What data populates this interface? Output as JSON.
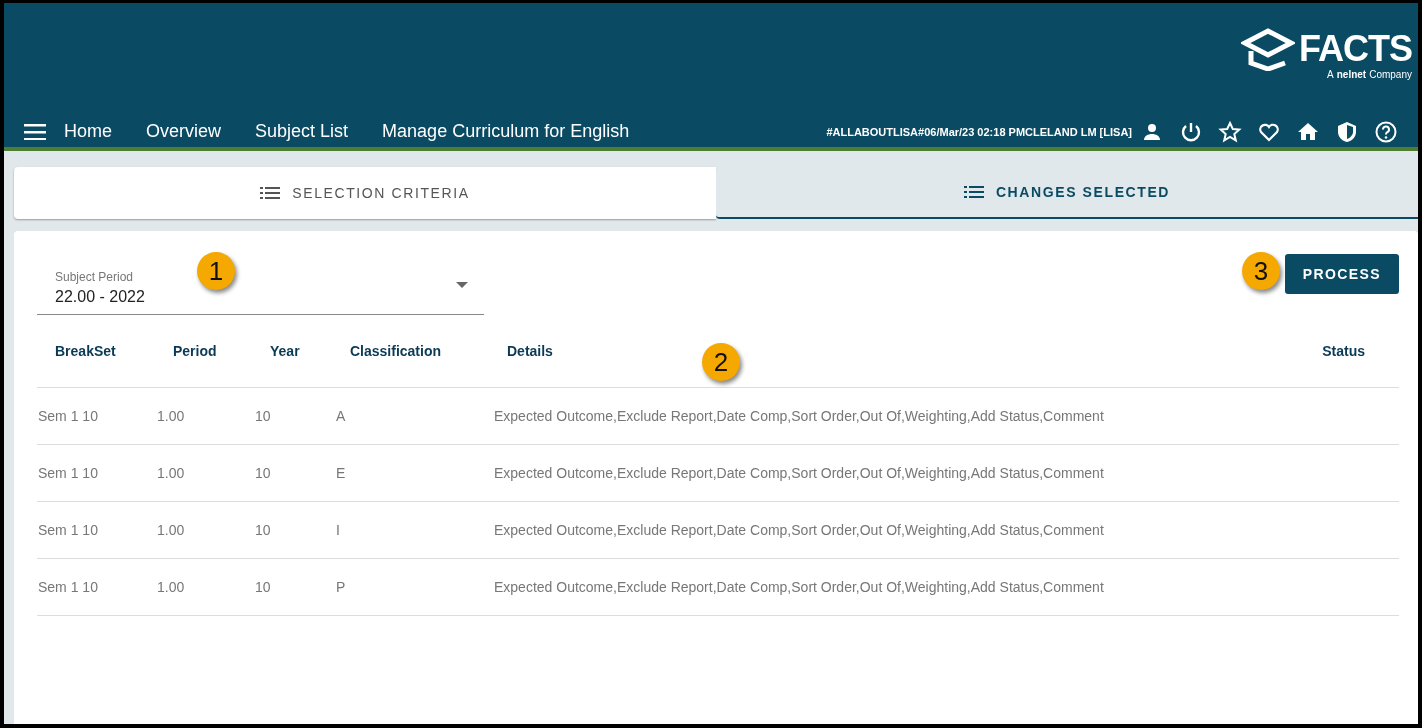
{
  "logo": {
    "name": "FACTS",
    "tagline_prefix": "A",
    "tagline_brand": "nelnet",
    "tagline_suffix": "Company"
  },
  "nav": {
    "items": [
      "Home",
      "Overview",
      "Subject List",
      "Manage Curriculum for English"
    ],
    "session": "#ALLABOUTLISA#06/Mar/23 02:18 PMCLELAND LM [LISA]"
  },
  "tabs": [
    {
      "label": "SELECTION CRITERIA",
      "selected": false
    },
    {
      "label": "CHANGES SELECTED",
      "selected": true
    }
  ],
  "subject_period": {
    "label": "Subject Period",
    "value": "22.00 - 2022"
  },
  "process_button": "PROCESS",
  "table": {
    "columns": [
      "BreakSet",
      "Period",
      "Year",
      "Classification",
      "Details",
      "Status"
    ],
    "rows": [
      [
        "Sem 1 10",
        "1.00",
        "10",
        "A",
        "Expected Outcome,Exclude Report,Date Comp,Sort Order,Out Of,Weighting,Add Status,Comment",
        ""
      ],
      [
        "Sem 1 10",
        "1.00",
        "10",
        "E",
        "Expected Outcome,Exclude Report,Date Comp,Sort Order,Out Of,Weighting,Add Status,Comment",
        ""
      ],
      [
        "Sem 1 10",
        "1.00",
        "10",
        "I",
        "Expected Outcome,Exclude Report,Date Comp,Sort Order,Out Of,Weighting,Add Status,Comment",
        ""
      ],
      [
        "Sem 1 10",
        "1.00",
        "10",
        "P",
        "Expected Outcome,Exclude Report,Date Comp,Sort Order,Out Of,Weighting,Add Status,Comment",
        ""
      ]
    ]
  },
  "callouts": [
    "1",
    "2",
    "3"
  ]
}
